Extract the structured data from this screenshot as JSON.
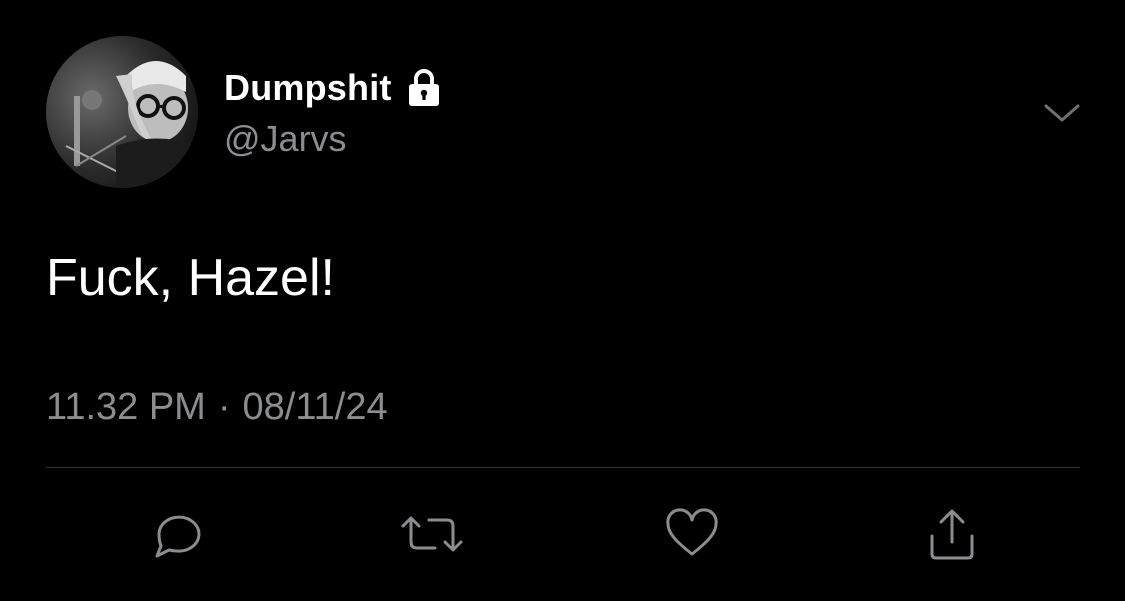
{
  "tweet": {
    "author": {
      "display_name": "Dumpshit",
      "handle": "@Jarvs",
      "protected": true,
      "avatar": "avatar-photo"
    },
    "text": "Fuck, Hazel!",
    "time": "11.32 PM",
    "separator": "·",
    "date": "08/11/24",
    "menu_icon": "chevron-down-icon"
  },
  "actions": [
    {
      "name": "reply",
      "icon": "reply-icon"
    },
    {
      "name": "retweet",
      "icon": "retweet-icon"
    },
    {
      "name": "like",
      "icon": "heart-icon"
    },
    {
      "name": "share",
      "icon": "share-icon"
    }
  ],
  "colors": {
    "background": "#000000",
    "primary_text": "#ffffff",
    "secondary_text": "#8b8d91",
    "divider": "#2f3336",
    "icon": "#8b8d91"
  }
}
